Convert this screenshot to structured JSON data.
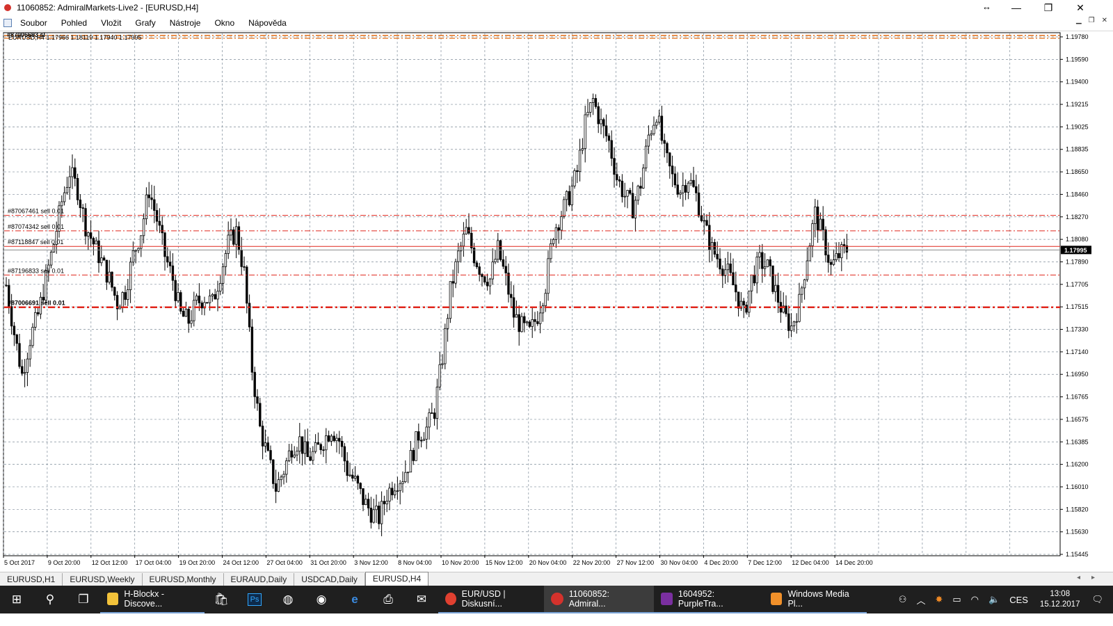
{
  "window": {
    "title": "11060852: AdmiralMarkets-Live2 - [EURUSD,H4]",
    "minimize_glyph": "—",
    "restore_glyph": "❐",
    "close_glyph": "✕",
    "resize_glyph": "↔"
  },
  "menu": [
    "Soubor",
    "Pohled",
    "Vložit",
    "Grafy",
    "Nástroje",
    "Okno",
    "Nápověda"
  ],
  "chart": {
    "header_text": "EURUSD,H4  1.17966 1.18119 1.17940 1.17995",
    "current_price_label": "1.17995",
    "order_lines": [
      {
        "label": "#87067461 sell 0.01",
        "price": 1.18285,
        "style": "dash-dot",
        "width": 1
      },
      {
        "label": "#87074342 sell 0.01",
        "price": 1.18155,
        "style": "dash-dot",
        "width": 1
      },
      {
        "label": "#87118847 sell 0.01",
        "price": 1.18025,
        "style": "solid",
        "width": 1
      },
      {
        "label": "#87196833 sell 0.01",
        "price": 1.17785,
        "style": "dash-dot",
        "width": 1
      },
      {
        "label": "#87006691 sell 0.01",
        "price": 1.17515,
        "style": "dash-dot",
        "width": 2.5
      }
    ],
    "top_level_label": "#87006693 sl",
    "colors": {
      "order_line": "#e0261c",
      "top_line": "#e06a10",
      "price_line": "#888888",
      "grid": "#7f8c99",
      "candle": "#000000"
    }
  },
  "chart_data": {
    "type": "candlestick",
    "title": "EURUSD,H4",
    "ohlc": {
      "open": 1.17966,
      "high": 1.18119,
      "low": 1.1794,
      "close": 1.17995
    },
    "y_ticks": [
      "1.19780",
      "1.19590",
      "1.19400",
      "1.19215",
      "1.19025",
      "1.18835",
      "1.18650",
      "1.18460",
      "1.18270",
      "1.18080",
      "1.17890",
      "1.17705",
      "1.17515",
      "1.17330",
      "1.17140",
      "1.16950",
      "1.16765",
      "1.16575",
      "1.16385",
      "1.16200",
      "1.16010",
      "1.15820",
      "1.15630",
      "1.15445"
    ],
    "ylim": [
      1.15445,
      1.1978
    ],
    "x_labels": [
      "5 Oct 2017",
      "9 Oct 20:00",
      "12 Oct 12:00",
      "17 Oct 04:00",
      "19 Oct 20:00",
      "24 Oct 12:00",
      "27 Oct 04:00",
      "31 Oct 20:00",
      "3 Nov 12:00",
      "8 Nov 04:00",
      "10 Nov 20:00",
      "15 Nov 12:00",
      "20 Nov 04:00",
      "22 Nov 20:00",
      "27 Nov 12:00",
      "30 Nov 04:00",
      "4 Dec 20:00",
      "7 Dec 12:00",
      "12 Dec 04:00",
      "14 Dec 20:00"
    ],
    "close_path": [
      [
        0,
        1.177
      ],
      [
        3,
        1.173
      ],
      [
        6,
        1.1695
      ],
      [
        9,
        1.1725
      ],
      [
        12,
        1.1745
      ],
      [
        15,
        1.1775
      ],
      [
        18,
        1.1805
      ],
      [
        21,
        1.184
      ],
      [
        24,
        1.1865
      ],
      [
        27,
        1.185
      ],
      [
        30,
        1.182
      ],
      [
        33,
        1.1805
      ],
      [
        36,
        1.179
      ],
      [
        39,
        1.1775
      ],
      [
        42,
        1.1755
      ],
      [
        45,
        1.1765
      ],
      [
        48,
        1.1795
      ],
      [
        51,
        1.1815
      ],
      [
        54,
        1.185
      ],
      [
        57,
        1.1825
      ],
      [
        60,
        1.1795
      ],
      [
        63,
        1.1775
      ],
      [
        66,
        1.1745
      ],
      [
        69,
        1.174
      ],
      [
        72,
        1.1755
      ],
      [
        75,
        1.176
      ],
      [
        78,
        1.1755
      ],
      [
        81,
        1.178
      ],
      [
        84,
        1.1805
      ],
      [
        87,
        1.1815
      ],
      [
        90,
        1.178
      ],
      [
        93,
        1.17
      ],
      [
        96,
        1.165
      ],
      [
        99,
        1.1625
      ],
      [
        102,
        1.16
      ],
      [
        105,
        1.1615
      ],
      [
        108,
        1.1635
      ],
      [
        111,
        1.164
      ],
      [
        114,
        1.1625
      ],
      [
        117,
        1.163
      ],
      [
        120,
        1.164
      ],
      [
        123,
        1.165
      ],
      [
        126,
        1.164
      ],
      [
        129,
        1.1615
      ],
      [
        132,
        1.1605
      ],
      [
        135,
        1.159
      ],
      [
        138,
        1.158
      ],
      [
        141,
        1.1575
      ],
      [
        144,
        1.1595
      ],
      [
        147,
        1.1605
      ],
      [
        150,
        1.161
      ],
      [
        153,
        1.1625
      ],
      [
        156,
        1.1645
      ],
      [
        159,
        1.165
      ],
      [
        162,
        1.1665
      ],
      [
        165,
        1.171
      ],
      [
        168,
        1.1765
      ],
      [
        171,
        1.1795
      ],
      [
        174,
        1.1815
      ],
      [
        177,
        1.1795
      ],
      [
        180,
        1.178
      ],
      [
        183,
        1.1775
      ],
      [
        186,
        1.18
      ],
      [
        189,
        1.1775
      ],
      [
        192,
        1.1745
      ],
      [
        195,
        1.1735
      ],
      [
        198,
        1.173
      ],
      [
        201,
        1.1745
      ],
      [
        204,
        1.177
      ],
      [
        207,
        1.1815
      ],
      [
        210,
        1.183
      ],
      [
        213,
        1.1845
      ],
      [
        216,
        1.1865
      ],
      [
        219,
        1.1905
      ],
      [
        222,
        1.1925
      ],
      [
        225,
        1.1905
      ],
      [
        228,
        1.189
      ],
      [
        231,
        1.186
      ],
      [
        234,
        1.1845
      ],
      [
        237,
        1.1835
      ],
      [
        240,
        1.1855
      ],
      [
        243,
        1.1895
      ],
      [
        246,
        1.1915
      ],
      [
        249,
        1.188
      ],
      [
        252,
        1.186
      ],
      [
        255,
        1.185
      ],
      [
        258,
        1.186
      ],
      [
        261,
        1.1845
      ],
      [
        264,
        1.182
      ],
      [
        267,
        1.18
      ],
      [
        270,
        1.179
      ],
      [
        273,
        1.178
      ],
      [
        276,
        1.1765
      ],
      [
        279,
        1.1745
      ],
      [
        282,
        1.1775
      ],
      [
        285,
        1.179
      ],
      [
        288,
        1.1785
      ],
      [
        291,
        1.1765
      ],
      [
        294,
        1.1745
      ],
      [
        297,
        1.1735
      ],
      [
        300,
        1.1755
      ],
      [
        303,
        1.1795
      ],
      [
        306,
        1.183
      ],
      [
        309,
        1.181
      ],
      [
        312,
        1.1785
      ],
      [
        315,
        1.1795
      ],
      [
        318,
        1.18
      ]
    ],
    "grid": true
  },
  "tabs": [
    {
      "label": "EURUSD,H1",
      "active": false
    },
    {
      "label": "EURUSD,Weekly",
      "active": false
    },
    {
      "label": "EURUSD,Monthly",
      "active": false
    },
    {
      "label": "EURAUD,Daily",
      "active": false
    },
    {
      "label": "USDCAD,Daily",
      "active": false
    },
    {
      "label": "EURUSD,H4",
      "active": true
    }
  ],
  "taskbar": {
    "apps": [
      {
        "label": "H-Blockx - Discove...",
        "icon_color": "#f2c23a",
        "active": false
      },
      {
        "label": "EUR/USD | Diskusní...",
        "icon_color": "#e04030",
        "active": false
      },
      {
        "label": "11060852: Admiral...",
        "icon_color": "#d4322c",
        "active": true
      },
      {
        "label": "1604952: PurpleTra...",
        "icon_color": "#7a2fa0",
        "active": false
      },
      {
        "label": "Windows Media Pl...",
        "icon_color": "#f0902a",
        "active": false
      }
    ],
    "lang": "CES",
    "time": "13:08",
    "date": "15.12.2017"
  }
}
